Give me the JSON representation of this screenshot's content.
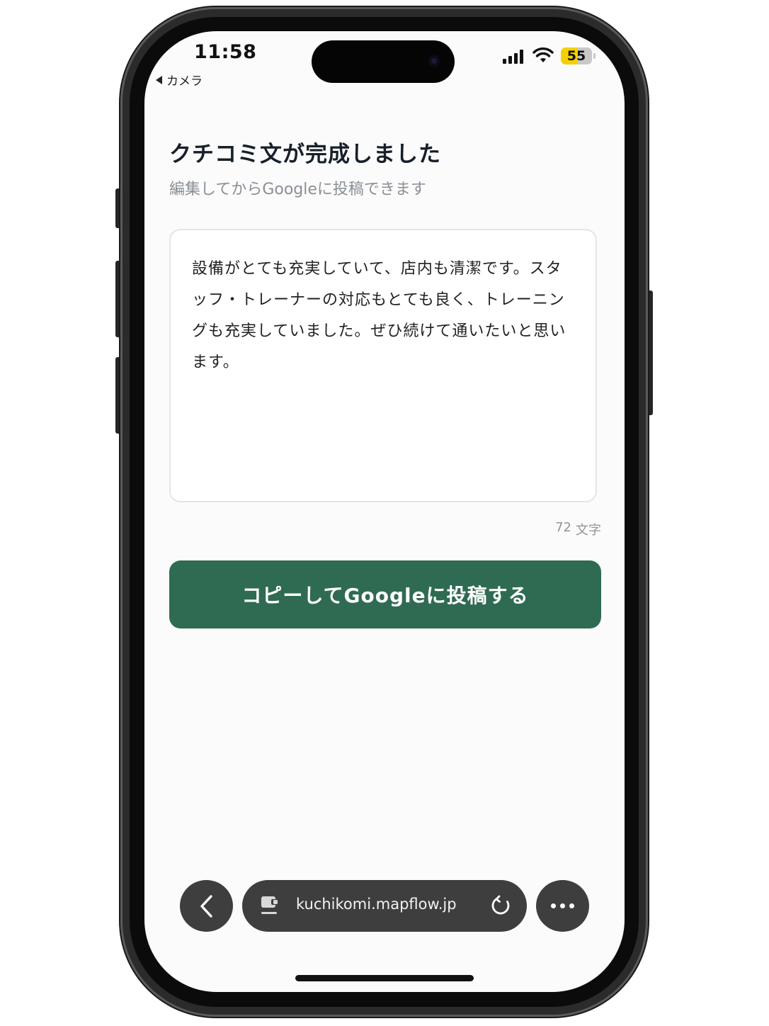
{
  "status_bar": {
    "time": "11:58",
    "back_app_label": "カメラ",
    "battery_level": "55",
    "battery_color": "#f5d000"
  },
  "page": {
    "title": "クチコミ文が完成しました",
    "subtitle": "編集してからGoogleに投稿できます"
  },
  "review": {
    "text": "設備がとても充実していて、店内も清潔です。スタッフ・トレーナーの対応もとても良く、トレーニングも充実していました。ぜひ続けて通いたいと思います。",
    "char_count": "72",
    "char_unit": "文字"
  },
  "cta": {
    "label": "コピーしてGoogleに投稿する",
    "color": "#2f6b52"
  },
  "browser": {
    "url": "kuchikomi.mapflow.jp",
    "back_icon": "chevron-left-icon",
    "site_icon": "site-settings-icon",
    "reload_icon": "reload-icon",
    "more_icon": "more-icon"
  }
}
